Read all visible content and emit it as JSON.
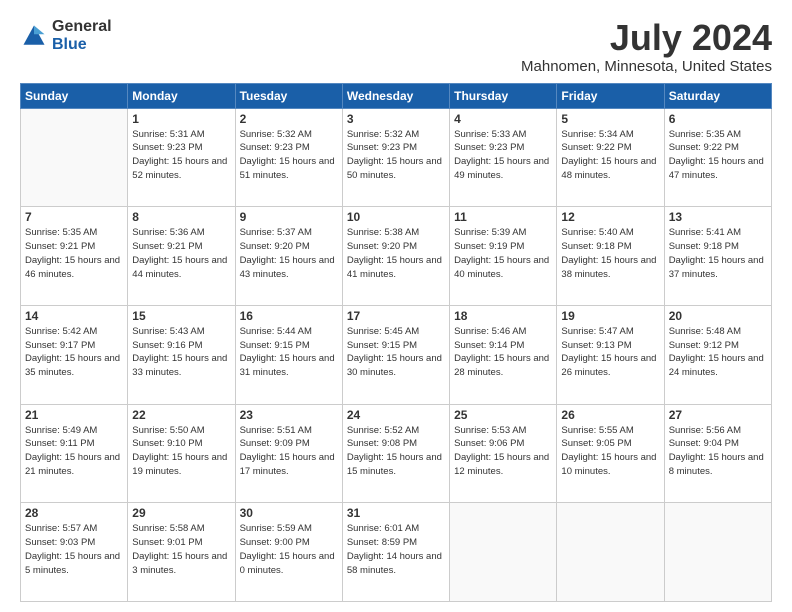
{
  "header": {
    "logo_general": "General",
    "logo_blue": "Blue",
    "title": "July 2024",
    "subtitle": "Mahnomen, Minnesota, United States"
  },
  "calendar": {
    "days_of_week": [
      "Sunday",
      "Monday",
      "Tuesday",
      "Wednesday",
      "Thursday",
      "Friday",
      "Saturday"
    ],
    "weeks": [
      [
        {
          "day": "",
          "info": ""
        },
        {
          "day": "1",
          "info": "Sunrise: 5:31 AM\nSunset: 9:23 PM\nDaylight: 15 hours\nand 52 minutes."
        },
        {
          "day": "2",
          "info": "Sunrise: 5:32 AM\nSunset: 9:23 PM\nDaylight: 15 hours\nand 51 minutes."
        },
        {
          "day": "3",
          "info": "Sunrise: 5:32 AM\nSunset: 9:23 PM\nDaylight: 15 hours\nand 50 minutes."
        },
        {
          "day": "4",
          "info": "Sunrise: 5:33 AM\nSunset: 9:23 PM\nDaylight: 15 hours\nand 49 minutes."
        },
        {
          "day": "5",
          "info": "Sunrise: 5:34 AM\nSunset: 9:22 PM\nDaylight: 15 hours\nand 48 minutes."
        },
        {
          "day": "6",
          "info": "Sunrise: 5:35 AM\nSunset: 9:22 PM\nDaylight: 15 hours\nand 47 minutes."
        }
      ],
      [
        {
          "day": "7",
          "info": "Sunrise: 5:35 AM\nSunset: 9:21 PM\nDaylight: 15 hours\nand 46 minutes."
        },
        {
          "day": "8",
          "info": "Sunrise: 5:36 AM\nSunset: 9:21 PM\nDaylight: 15 hours\nand 44 minutes."
        },
        {
          "day": "9",
          "info": "Sunrise: 5:37 AM\nSunset: 9:20 PM\nDaylight: 15 hours\nand 43 minutes."
        },
        {
          "day": "10",
          "info": "Sunrise: 5:38 AM\nSunset: 9:20 PM\nDaylight: 15 hours\nand 41 minutes."
        },
        {
          "day": "11",
          "info": "Sunrise: 5:39 AM\nSunset: 9:19 PM\nDaylight: 15 hours\nand 40 minutes."
        },
        {
          "day": "12",
          "info": "Sunrise: 5:40 AM\nSunset: 9:18 PM\nDaylight: 15 hours\nand 38 minutes."
        },
        {
          "day": "13",
          "info": "Sunrise: 5:41 AM\nSunset: 9:18 PM\nDaylight: 15 hours\nand 37 minutes."
        }
      ],
      [
        {
          "day": "14",
          "info": "Sunrise: 5:42 AM\nSunset: 9:17 PM\nDaylight: 15 hours\nand 35 minutes."
        },
        {
          "day": "15",
          "info": "Sunrise: 5:43 AM\nSunset: 9:16 PM\nDaylight: 15 hours\nand 33 minutes."
        },
        {
          "day": "16",
          "info": "Sunrise: 5:44 AM\nSunset: 9:15 PM\nDaylight: 15 hours\nand 31 minutes."
        },
        {
          "day": "17",
          "info": "Sunrise: 5:45 AM\nSunset: 9:15 PM\nDaylight: 15 hours\nand 30 minutes."
        },
        {
          "day": "18",
          "info": "Sunrise: 5:46 AM\nSunset: 9:14 PM\nDaylight: 15 hours\nand 28 minutes."
        },
        {
          "day": "19",
          "info": "Sunrise: 5:47 AM\nSunset: 9:13 PM\nDaylight: 15 hours\nand 26 minutes."
        },
        {
          "day": "20",
          "info": "Sunrise: 5:48 AM\nSunset: 9:12 PM\nDaylight: 15 hours\nand 24 minutes."
        }
      ],
      [
        {
          "day": "21",
          "info": "Sunrise: 5:49 AM\nSunset: 9:11 PM\nDaylight: 15 hours\nand 21 minutes."
        },
        {
          "day": "22",
          "info": "Sunrise: 5:50 AM\nSunset: 9:10 PM\nDaylight: 15 hours\nand 19 minutes."
        },
        {
          "day": "23",
          "info": "Sunrise: 5:51 AM\nSunset: 9:09 PM\nDaylight: 15 hours\nand 17 minutes."
        },
        {
          "day": "24",
          "info": "Sunrise: 5:52 AM\nSunset: 9:08 PM\nDaylight: 15 hours\nand 15 minutes."
        },
        {
          "day": "25",
          "info": "Sunrise: 5:53 AM\nSunset: 9:06 PM\nDaylight: 15 hours\nand 12 minutes."
        },
        {
          "day": "26",
          "info": "Sunrise: 5:55 AM\nSunset: 9:05 PM\nDaylight: 15 hours\nand 10 minutes."
        },
        {
          "day": "27",
          "info": "Sunrise: 5:56 AM\nSunset: 9:04 PM\nDaylight: 15 hours\nand 8 minutes."
        }
      ],
      [
        {
          "day": "28",
          "info": "Sunrise: 5:57 AM\nSunset: 9:03 PM\nDaylight: 15 hours\nand 5 minutes."
        },
        {
          "day": "29",
          "info": "Sunrise: 5:58 AM\nSunset: 9:01 PM\nDaylight: 15 hours\nand 3 minutes."
        },
        {
          "day": "30",
          "info": "Sunrise: 5:59 AM\nSunset: 9:00 PM\nDaylight: 15 hours\nand 0 minutes."
        },
        {
          "day": "31",
          "info": "Sunrise: 6:01 AM\nSunset: 8:59 PM\nDaylight: 14 hours\nand 58 minutes."
        },
        {
          "day": "",
          "info": ""
        },
        {
          "day": "",
          "info": ""
        },
        {
          "day": "",
          "info": ""
        }
      ]
    ]
  }
}
